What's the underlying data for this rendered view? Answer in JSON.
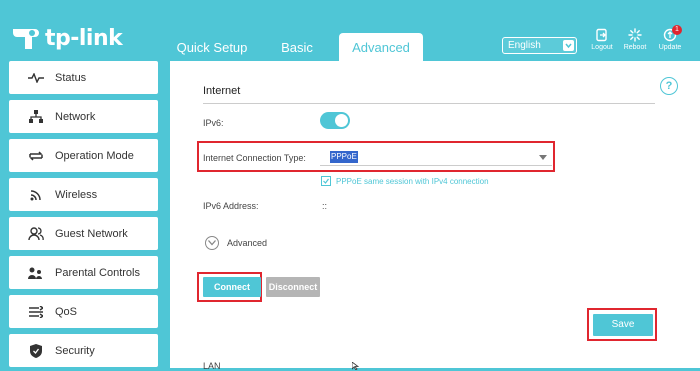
{
  "brand": {
    "name": "tp-link",
    "accent": "#4fc6d6",
    "highlight": "#e0262f"
  },
  "header": {
    "tabs": [
      {
        "label": "Quick Setup",
        "active": false
      },
      {
        "label": "Basic",
        "active": false
      },
      {
        "label": "Advanced",
        "active": true
      }
    ],
    "language": {
      "selected": "English"
    },
    "actions": [
      {
        "label": "Logout",
        "icon": "logout-icon"
      },
      {
        "label": "Reboot",
        "icon": "reboot-icon"
      },
      {
        "label": "Update",
        "icon": "update-icon",
        "badge": "1"
      }
    ]
  },
  "sidebar": {
    "items": [
      {
        "label": "Status",
        "icon": "pulse-icon"
      },
      {
        "label": "Network",
        "icon": "network-icon"
      },
      {
        "label": "Operation Mode",
        "icon": "operation-mode-icon"
      },
      {
        "label": "Wireless",
        "icon": "wifi-icon"
      },
      {
        "label": "Guest Network",
        "icon": "guest-icon"
      },
      {
        "label": "Parental Controls",
        "icon": "parental-icon"
      },
      {
        "label": "QoS",
        "icon": "qos-icon"
      },
      {
        "label": "Security",
        "icon": "shield-icon"
      }
    ]
  },
  "main": {
    "section_title": "Internet",
    "help_glyph": "?",
    "ipv6": {
      "label": "IPv6:",
      "enabled": true
    },
    "connection_type": {
      "label": "Internet Connection Type:",
      "value": "PPPoE"
    },
    "pppoe_same_session": {
      "label": "PPPoE same session with IPv4 connection",
      "checked": true
    },
    "ipv6_address": {
      "label": "IPv6 Address:",
      "value": "::"
    },
    "advanced_toggle": {
      "label": "Advanced"
    },
    "buttons": {
      "connect": "Connect",
      "disconnect": "Disconnect",
      "save": "Save"
    },
    "next_section_peek": "LAN"
  }
}
